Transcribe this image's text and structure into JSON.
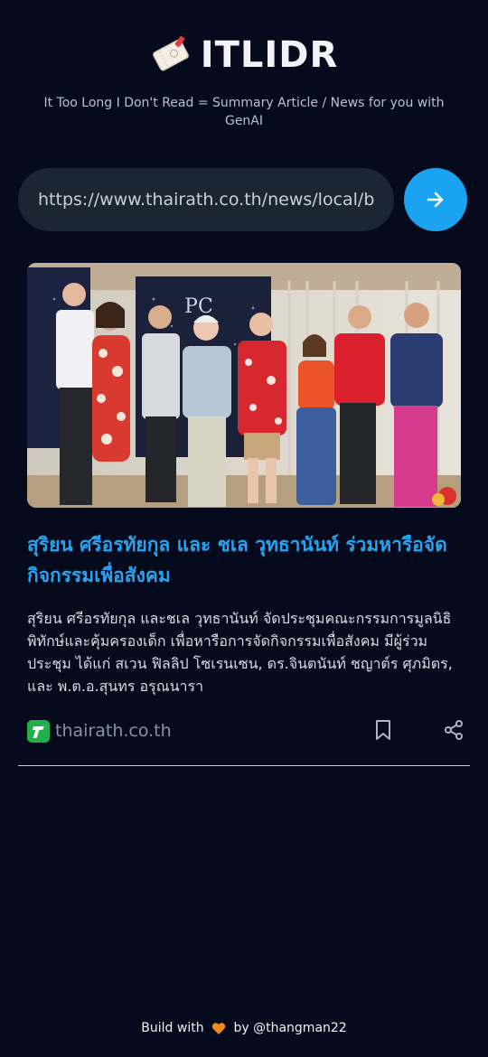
{
  "app": {
    "title": "ITLIDR",
    "tagline": "It Too Long I Don't Read = Summary Article / News for you with GenAI"
  },
  "search": {
    "url_value": "https://www.thairath.co.th/news/local/bangkok/"
  },
  "article": {
    "headline": "สุริยน ศรีอรทัยกุล และ ชเล วุทธานันท์ ร่วมหารือจัดกิจกรรมเพื่อสังคม",
    "summary": "สุริยน ศรีอรทัยกุล และชเล วุทธานันท์ จัดประชุมคณะกรรมการมูลนิธิพิทักษ์และคุ้มครองเด็ก เพื่อหารือการจัดกิจกรรมเพื่อสังคม มีผู้ร่วมประชุม ได้แก่ สเวน ฟิลลิป โซเรนเซน, ดร.จินตนันท์ ชญาต์ร ศุภมิตร, และ พ.ต.อ.สุนทร อรุณนารา",
    "source_name": "thairath.co.th",
    "backdrop_text": "PC"
  },
  "footer": {
    "prefix": "Build with",
    "suffix": "by @thangman22"
  },
  "colors": {
    "background": "#050b1c",
    "accent": "#1aa3f0",
    "headline": "#29a3ef",
    "source_logo": "#22b04a"
  },
  "icons": {
    "logo": "ticket-icon",
    "go": "arrow-right-icon",
    "bookmark": "bookmark-icon",
    "share": "share-icon",
    "heart": "heart-icon"
  }
}
